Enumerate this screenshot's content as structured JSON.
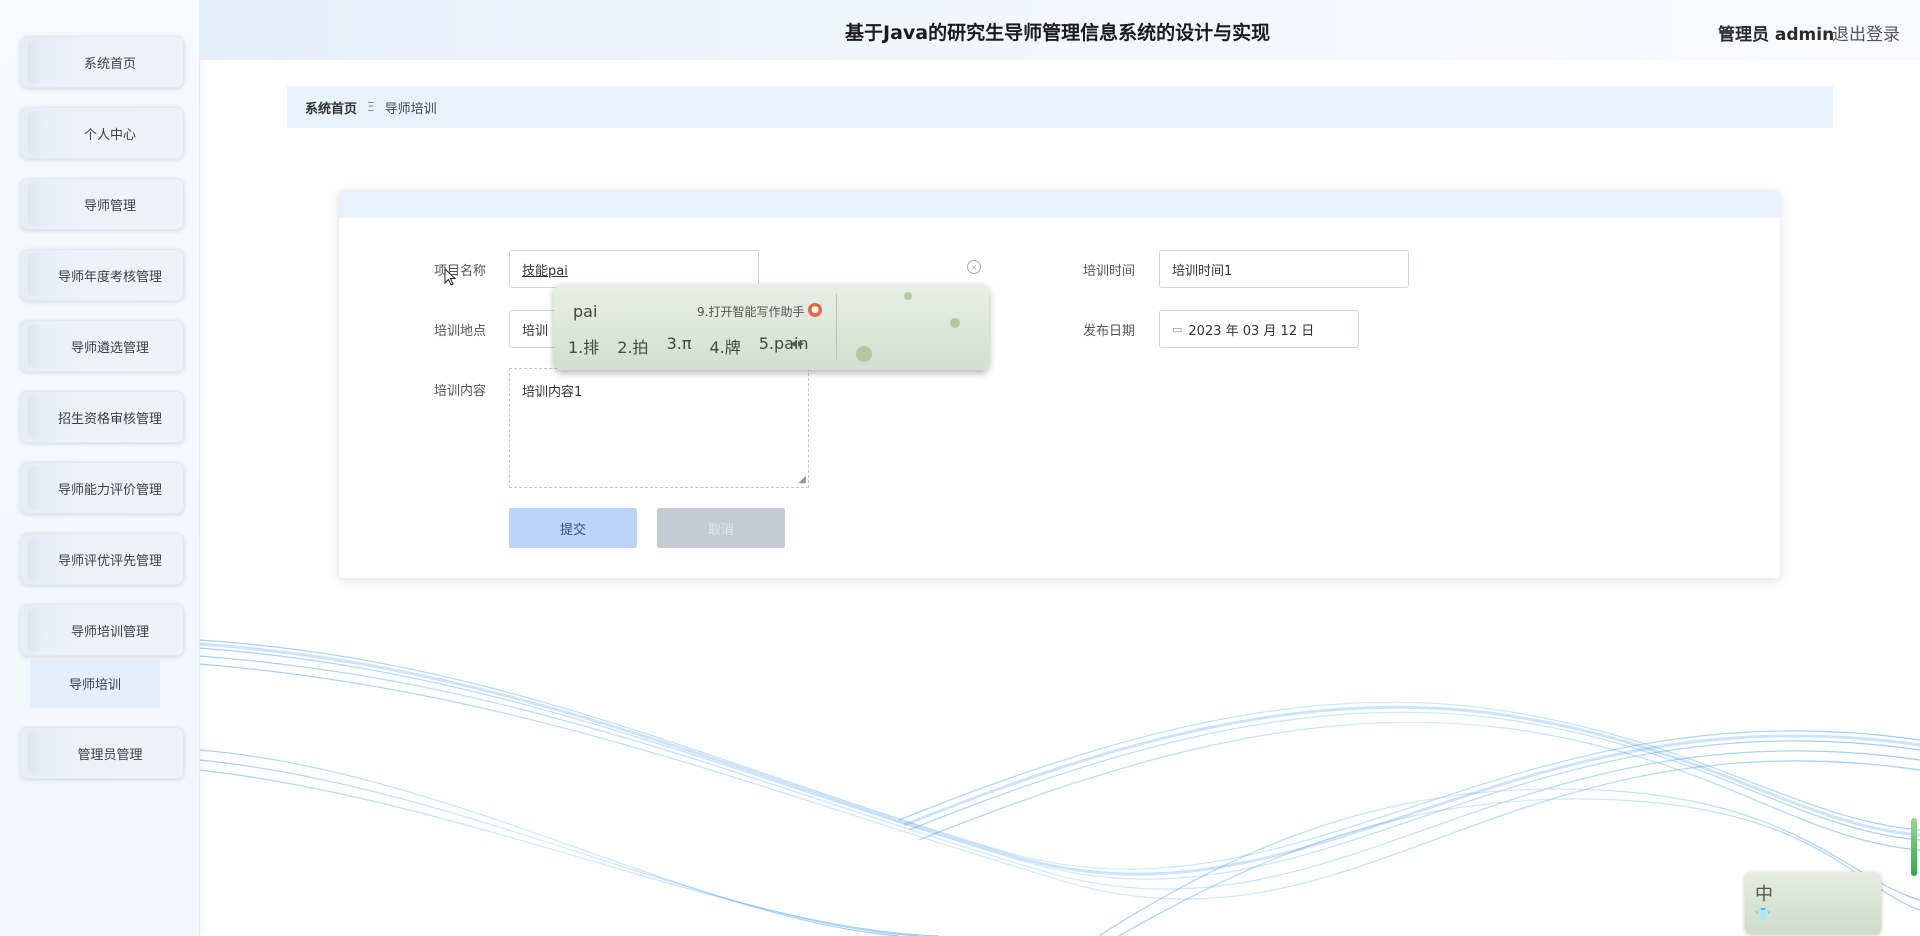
{
  "header": {
    "title": "基于Java的研究生导师管理信息系统的设计与实现",
    "user": "管理员 admin",
    "logout": "退出登录"
  },
  "sidebar": {
    "items": [
      {
        "label": "系统首页"
      },
      {
        "label": "个人中心"
      },
      {
        "label": "导师管理"
      },
      {
        "label": "导师年度考核管理"
      },
      {
        "label": "导师遴选管理"
      },
      {
        "label": "招生资格审核管理"
      },
      {
        "label": "导师能力评价管理"
      },
      {
        "label": "导师评优评先管理"
      },
      {
        "label": "导师培训管理"
      },
      {
        "label": "管理员管理"
      }
    ],
    "sub_item": "导师培训"
  },
  "breadcrumb": {
    "home": "系统首页",
    "separator": "Ξ",
    "current": "导师培训"
  },
  "form": {
    "project_name_label": "项目名称",
    "project_name_value": "技能pai",
    "location_label": "培训地点",
    "location_value": "培训",
    "content_label": "培训内容",
    "content_value": "培训内容1",
    "time_label": "培训时间",
    "time_value": "培训时间1",
    "date_label": "发布日期",
    "date_value": "2023 年 03 月 12 日",
    "submit_label": "提交",
    "cancel_label": "取消"
  },
  "ime": {
    "pinyin": "pai",
    "assist": "9.打开智能写作助手",
    "candidates": [
      "1.排",
      "2.拍",
      "3.π",
      "4.牌",
      "5.pain"
    ],
    "status_char": "中"
  }
}
